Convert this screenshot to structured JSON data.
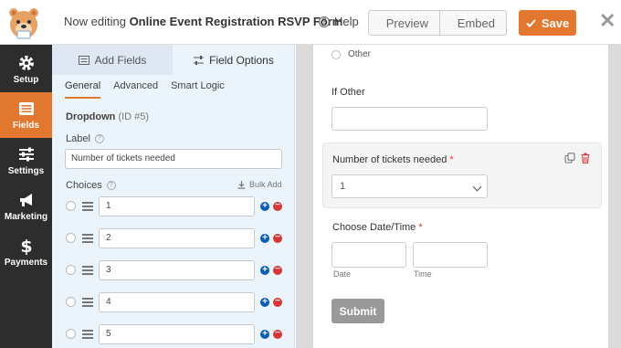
{
  "header": {
    "title_prefix": "Now editing",
    "form_name": "Online Event Registration RSVP Form",
    "help": "Help",
    "preview": "Preview",
    "embed": "Embed",
    "save": "Save"
  },
  "nav": {
    "items": [
      {
        "label": "Setup",
        "icon": "gear-icon"
      },
      {
        "label": "Fields",
        "icon": "fields-icon",
        "active": true
      },
      {
        "label": "Settings",
        "icon": "sliders-icon"
      },
      {
        "label": "Marketing",
        "icon": "megaphone-icon"
      },
      {
        "label": "Payments",
        "icon": "dollar-icon"
      }
    ]
  },
  "panel": {
    "tabs": [
      "Add Fields",
      "Field Options"
    ],
    "subtabs": [
      "General",
      "Advanced",
      "Smart Logic"
    ],
    "field_type": "Dropdown",
    "field_id": "(ID #5)",
    "label_caption": "Label",
    "label_value": "Number of tickets needed",
    "choices_caption": "Choices",
    "bulk_add": "Bulk Add",
    "choices": [
      "1",
      "2",
      "3",
      "4",
      "5"
    ]
  },
  "form": {
    "other_option": "Other",
    "if_other_label": "If Other",
    "dropdown_label": "Number of tickets needed",
    "dropdown_value": "1",
    "required_mark": "*",
    "datetime_label": "Choose Date/Time",
    "date_sublabel": "Date",
    "time_sublabel": "Time",
    "submit": "Submit"
  },
  "colors": {
    "accent": "#e27730",
    "nav_bg": "#2d2d2d",
    "panel_bg": "#ebf3fb",
    "required": "#d63638"
  }
}
